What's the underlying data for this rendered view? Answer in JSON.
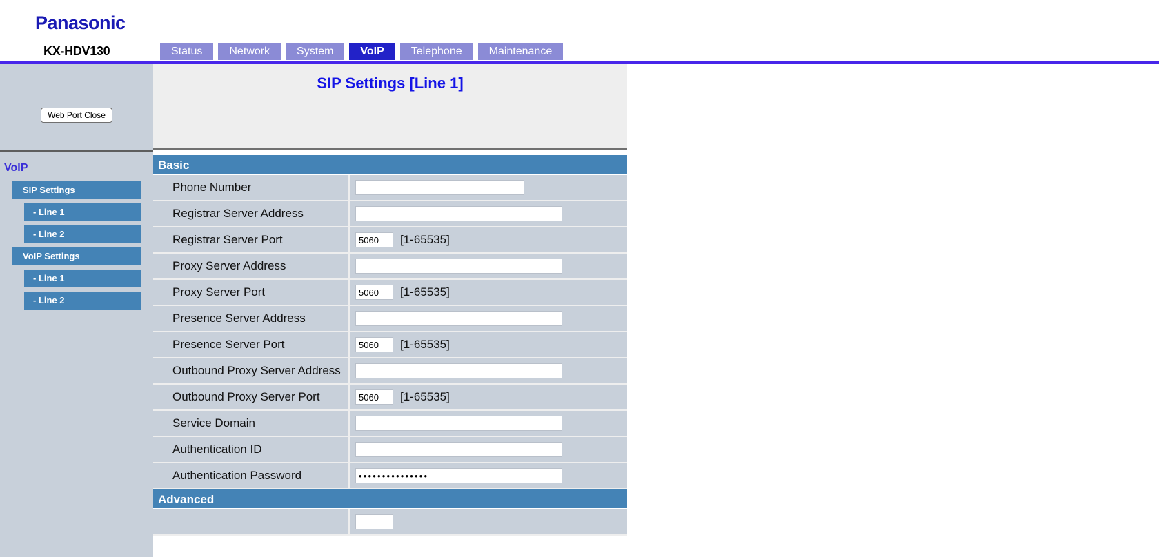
{
  "header": {
    "brand": "Panasonic",
    "model": "KX-HDV130",
    "tabs": [
      {
        "label": "Status",
        "active": false
      },
      {
        "label": "Network",
        "active": false
      },
      {
        "label": "System",
        "active": false
      },
      {
        "label": "VoIP",
        "active": true
      },
      {
        "label": "Telephone",
        "active": false
      },
      {
        "label": "Maintenance",
        "active": false
      }
    ]
  },
  "sidebar": {
    "web_port_button": "Web Port Close",
    "heading": "VoIP",
    "items": [
      {
        "label": "SIP Settings",
        "level": 1
      },
      {
        "label": "- Line 1",
        "level": 2
      },
      {
        "label": "- Line 2",
        "level": 2
      },
      {
        "label": "VoIP Settings",
        "level": 1
      },
      {
        "label": "- Line 1",
        "level": 2
      },
      {
        "label": "- Line 2",
        "level": 2
      }
    ]
  },
  "main": {
    "page_title": "SIP Settings [Line 1]",
    "sections": [
      {
        "title": "Basic",
        "rows": [
          {
            "label": "Phone Number",
            "field": "text",
            "size": "medium",
            "value": "",
            "hint": ""
          },
          {
            "label": "Registrar Server Address",
            "field": "text",
            "size": "wide",
            "value": "",
            "hint": ""
          },
          {
            "label": "Registrar Server Port",
            "field": "text",
            "size": "small",
            "value": "5060",
            "hint": "[1-65535]"
          },
          {
            "label": "Proxy Server Address",
            "field": "text",
            "size": "wide",
            "value": "",
            "hint": ""
          },
          {
            "label": "Proxy Server Port",
            "field": "text",
            "size": "small",
            "value": "5060",
            "hint": "[1-65535]"
          },
          {
            "label": "Presence Server Address",
            "field": "text",
            "size": "wide",
            "value": "",
            "hint": ""
          },
          {
            "label": "Presence Server Port",
            "field": "text",
            "size": "small",
            "value": "5060",
            "hint": "[1-65535]"
          },
          {
            "label": "Outbound Proxy Server Address",
            "field": "text",
            "size": "wide",
            "value": "",
            "hint": ""
          },
          {
            "label": "Outbound Proxy Server Port",
            "field": "text",
            "size": "small",
            "value": "5060",
            "hint": "[1-65535]"
          },
          {
            "label": "Service Domain",
            "field": "text",
            "size": "wide",
            "value": "",
            "hint": ""
          },
          {
            "label": "Authentication ID",
            "field": "text",
            "size": "wide",
            "value": "",
            "hint": ""
          },
          {
            "label": "Authentication Password",
            "field": "password",
            "size": "wide",
            "value": "•••••••••••••••",
            "hint": ""
          }
        ]
      },
      {
        "title": "Advanced",
        "rows": [
          {
            "label": "",
            "field": "text",
            "size": "small",
            "value": "",
            "hint": ""
          }
        ]
      }
    ]
  },
  "colors": {
    "tab": "#8b8bd6",
    "tab_active": "#2222c8",
    "rule": "#4826ea",
    "sidebar_bg": "#c8d0da",
    "nav_item": "#4483b6",
    "section_head": "#4483b6",
    "brand": "#1a1ab4",
    "title": "#1414e6"
  }
}
